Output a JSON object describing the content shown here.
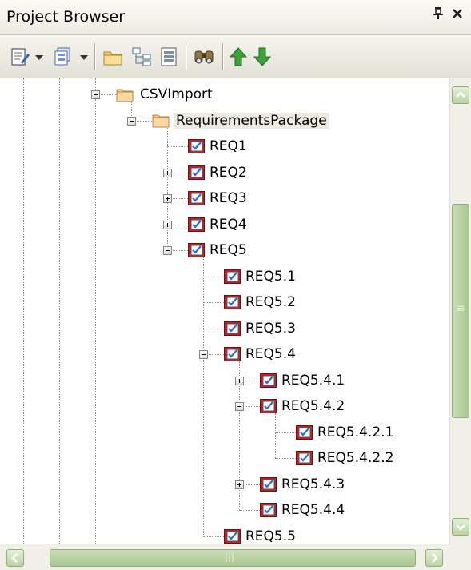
{
  "window": {
    "title": "Project Browser",
    "pin_glyph": "ᵽ",
    "close_glyph": "✕"
  },
  "toolbar": {
    "buttons": [
      {
        "name": "new-element-icon",
        "has_dropdown": true
      },
      {
        "name": "new-diagram-icon",
        "has_dropdown": true
      },
      {
        "name": "folder-icon"
      },
      {
        "name": "hierarchy-icon"
      },
      {
        "name": "properties-icon"
      },
      {
        "name": "find-binoculars-icon"
      },
      {
        "name": "move-up-icon"
      },
      {
        "name": "move-down-icon"
      }
    ]
  },
  "tree": {
    "nodes": [
      {
        "label": "CSVImport",
        "type": "package",
        "depth": 0,
        "toggle": "minus"
      },
      {
        "label": "RequirementsPackage",
        "type": "package",
        "depth": 1,
        "toggle": "minus",
        "selected": true
      },
      {
        "label": "REQ1",
        "type": "requirement",
        "depth": 2,
        "toggle": "none"
      },
      {
        "label": "REQ2",
        "type": "requirement",
        "depth": 2,
        "toggle": "plus"
      },
      {
        "label": "REQ3",
        "type": "requirement",
        "depth": 2,
        "toggle": "plus"
      },
      {
        "label": "REQ4",
        "type": "requirement",
        "depth": 2,
        "toggle": "plus"
      },
      {
        "label": "REQ5",
        "type": "requirement",
        "depth": 2,
        "toggle": "minus"
      },
      {
        "label": "REQ5.1",
        "type": "requirement",
        "depth": 3,
        "toggle": "none"
      },
      {
        "label": "REQ5.2",
        "type": "requirement",
        "depth": 3,
        "toggle": "none"
      },
      {
        "label": "REQ5.3",
        "type": "requirement",
        "depth": 3,
        "toggle": "none"
      },
      {
        "label": "REQ5.4",
        "type": "requirement",
        "depth": 3,
        "toggle": "minus"
      },
      {
        "label": "REQ5.4.1",
        "type": "requirement",
        "depth": 4,
        "toggle": "plus"
      },
      {
        "label": "REQ5.4.2",
        "type": "requirement",
        "depth": 4,
        "toggle": "minus"
      },
      {
        "label": "REQ5.4.2.1",
        "type": "requirement",
        "depth": 5,
        "toggle": "none"
      },
      {
        "label": "REQ5.4.2.2",
        "type": "requirement",
        "depth": 5,
        "toggle": "none"
      },
      {
        "label": "REQ5.4.3",
        "type": "requirement",
        "depth": 4,
        "toggle": "plus"
      },
      {
        "label": "REQ5.4.4",
        "type": "requirement",
        "depth": 4,
        "toggle": "none"
      },
      {
        "label": "REQ5.5",
        "type": "requirement",
        "depth": 3,
        "toggle": "none"
      }
    ]
  },
  "scrollbars": {
    "vertical_grip": "≡",
    "horizontal_grip": "|||"
  },
  "colors": {
    "req_red": "#c0202a",
    "req_check": "#2a6fc9",
    "folder": "#f6c77b",
    "scroll_green": "#b3cf9b",
    "selection": "#eeeae0"
  }
}
